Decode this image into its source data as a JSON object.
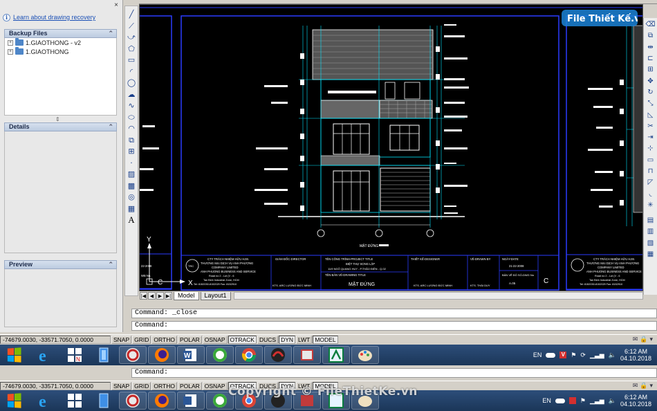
{
  "left_panel": {
    "close_glyph": "×",
    "info_glyph": "i",
    "recovery_link": "Learn about drawing recovery",
    "backup_header": "Backup Files",
    "backup_items": [
      "1.GIAOTHONG - v2",
      "1.GIAOTHONG"
    ],
    "details_header": "Details",
    "preview_header": "Preview",
    "collapse_glyph": "⌃"
  },
  "drawing": {
    "ucs_y": "Y",
    "ucs_x": "X",
    "ucs_c": "C",
    "left_small_label": "WB No.",
    "left_date": "22-2008",
    "elevation_label": "MẶT ĐỨNG",
    "titleblock": {
      "company": [
        "CTY TRÁCH NHIỆM HỮU HẠN",
        "THƯƠNG MẠI DỊCH VỤ ANH PHƯƠNG",
        "COMPANY LIMITED",
        "ANH PHUONG BUSINESS AND SERVICE"
      ],
      "company_addr": [
        "Road no 2 - Lot (V - 6",
        "Tan Binh Industrial Zone, HCM",
        "Tel: 8152030-8152029 Fax: 8152910"
      ],
      "director_label": "GIÁM ĐỐC-DIRECTOR",
      "project_label": "TÊN CÔNG TRÌNH-PROJECT TITLE",
      "project_name": "BIỆT THỰ SONG LẬP",
      "project_addr": "11/9 NGÔ QUANG HUY - P.THẢO ĐIỀN - Q.02",
      "drawing_label": "TÊN BẢN VẼ-DRAWING TITLE",
      "drawing_name": "MẶT ĐỨNG",
      "designer_label": "THIẾT KẾ-DESIGNER",
      "drawn_label": "VẼ-DRAWN BY",
      "date_label": "NGÀY-DATE",
      "date_value": "21-22-2008",
      "drawing_no_label": "BẢN VẼ ĐỐ SỐ-DWG No",
      "drawing_no_value": "A.05",
      "sheet_letter": "C",
      "sign_kts": "KTS. ARC LƯƠNG ĐỨC MINH",
      "sign_kts2": "KTS. ARC LƯƠNG ĐỨC MINH",
      "sign_kts3": "KTS. THÁI DUY"
    }
  },
  "layout_tabs": {
    "nav": [
      "|◀",
      "◀",
      "▶",
      "▶|"
    ],
    "tabs": [
      {
        "label": "Model",
        "active": true
      },
      {
        "label": "Layout1",
        "active": false
      }
    ]
  },
  "command": {
    "history_line": "Command: _close",
    "prompt": "Command:",
    "prompt2": "Command:"
  },
  "status": {
    "coordinates": "-74679.0030, -33571.7050, 0.0000",
    "toggles": [
      {
        "label": "SNAP",
        "on": false
      },
      {
        "label": "GRID",
        "on": false
      },
      {
        "label": "ORTHO",
        "on": false
      },
      {
        "label": "POLAR",
        "on": false
      },
      {
        "label": "OSNAP",
        "on": false
      },
      {
        "label": "OTRACK",
        "on": true
      },
      {
        "label": "DUCS",
        "on": false
      },
      {
        "label": "DYN",
        "on": true
      },
      {
        "label": "LWT",
        "on": false
      },
      {
        "label": "MODEL",
        "on": true
      }
    ]
  },
  "taskbar": {
    "language": "EN",
    "time": "6:12 AM",
    "date": "04.10.2018",
    "apps": [
      "internet-explorer",
      "unikey",
      "file-explorer",
      "adobe-app",
      "firefox",
      "word",
      "app-green",
      "chrome",
      "app-red",
      "app-window",
      "autocad",
      "paint"
    ]
  },
  "watermark": {
    "logo_text": "File Thiết Kế.vn",
    "copyright": "Copyright © FileThietKe.vn"
  },
  "colors": {
    "canvas_bg": "#000000",
    "cad_blue": "#2a3cff",
    "cad_cyan": "#00e5ff",
    "cad_white": "#ffffff",
    "taskbar": "#1e3a5f"
  }
}
